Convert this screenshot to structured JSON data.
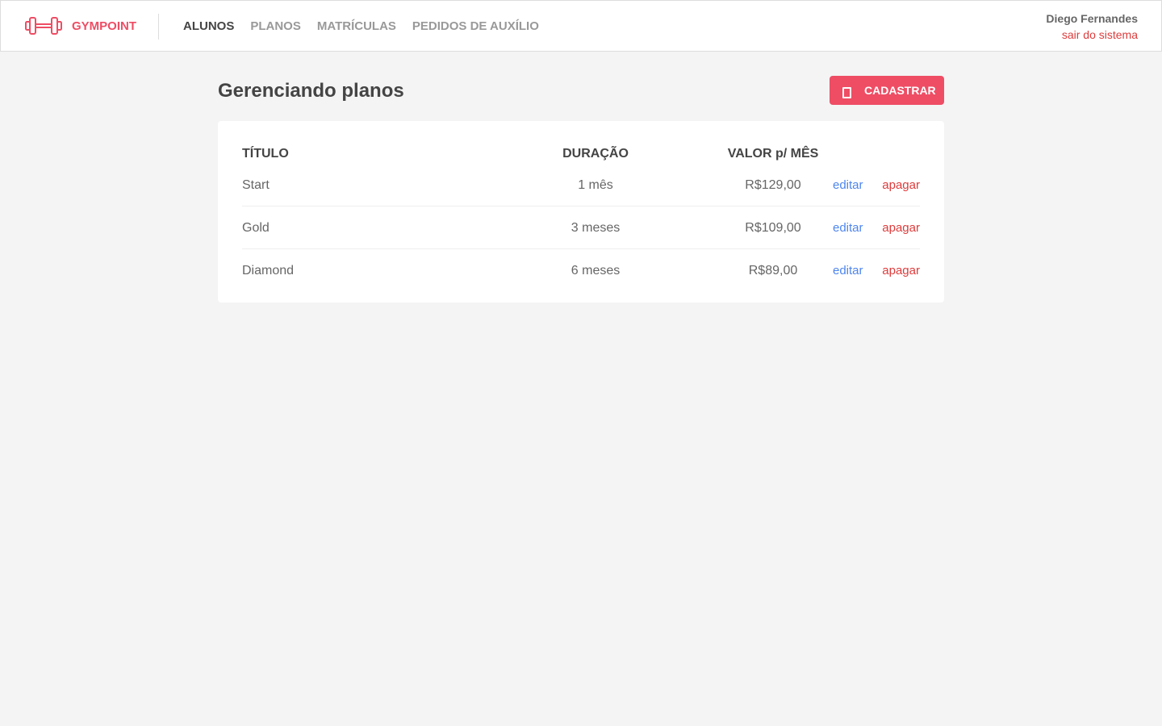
{
  "brand": {
    "name": "GYMPOINT",
    "icon": "dumbbell-icon",
    "color": "#ee4d64"
  },
  "nav": [
    {
      "label": "ALUNOS",
      "active": true
    },
    {
      "label": "PLANOS",
      "active": false
    },
    {
      "label": "MATRÍCULAS",
      "active": false
    },
    {
      "label": "PEDIDOS DE AUXÍLIO",
      "active": false
    }
  ],
  "user": {
    "name": "Diego Fernandes",
    "logout_label": "sair do sistema"
  },
  "page": {
    "title": "Gerenciando planos",
    "add_button_label": "CADASTRAR",
    "add_button_icon": "add-icon"
  },
  "table": {
    "headers": {
      "title": "TÍTULO",
      "duration": "DURAÇÃO",
      "price": "VALOR p/ MÊS"
    },
    "rows": [
      {
        "title": "Start",
        "duration": "1 mês",
        "price": "R$129,00",
        "edit": "editar",
        "delete": "apagar"
      },
      {
        "title": "Gold",
        "duration": "3 meses",
        "price": "R$109,00",
        "edit": "editar",
        "delete": "apagar"
      },
      {
        "title": "Diamond",
        "duration": "6 meses",
        "price": "R$89,00",
        "edit": "editar",
        "delete": "apagar"
      }
    ]
  },
  "colors": {
    "primary": "#ee4d64",
    "link_edit": "#4d85ee",
    "link_delete": "#de3b3b",
    "background": "#f4f4f4"
  }
}
